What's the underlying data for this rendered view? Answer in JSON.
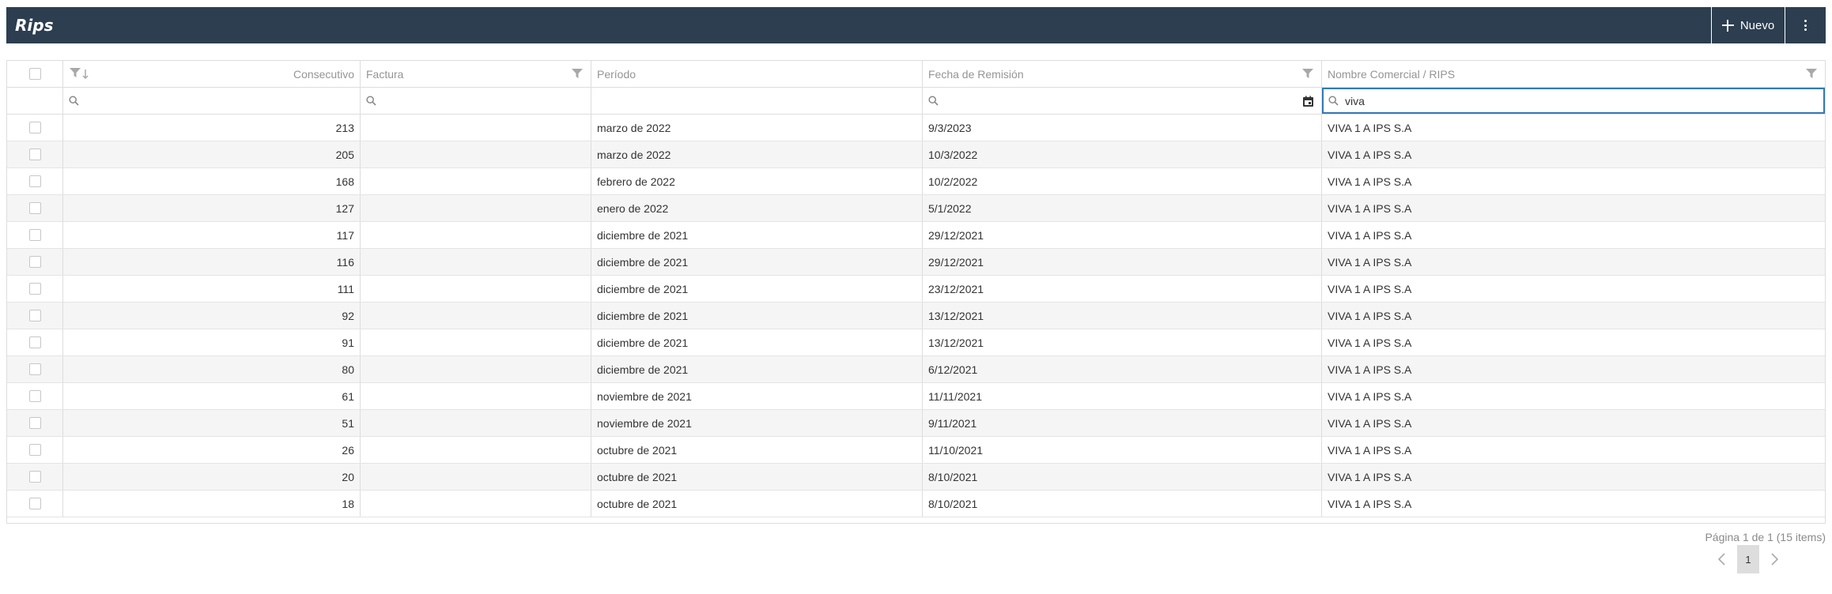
{
  "toolbar": {
    "title": "Rips",
    "new_label": "Nuevo",
    "new_icon": "plus-icon",
    "more_icon": "kebab-menu-icon",
    "background": "#2c3e50"
  },
  "grid": {
    "columns": {
      "consecutivo": "Consecutivo",
      "factura": "Factura",
      "periodo": "Período",
      "fecha": "Fecha de Remisión",
      "nombre": "Nombre Comercial / RIPS"
    },
    "filters": {
      "consecutivo": "",
      "factura": "",
      "fecha": "",
      "nombre": "viva"
    },
    "rows": [
      {
        "consecutivo": "213",
        "factura": "",
        "periodo": "marzo de 2022",
        "fecha": "9/3/2023",
        "nombre": "VIVA 1 A IPS S.A"
      },
      {
        "consecutivo": "205",
        "factura": "",
        "periodo": "marzo de 2022",
        "fecha": "10/3/2022",
        "nombre": "VIVA 1 A IPS S.A"
      },
      {
        "consecutivo": "168",
        "factura": "",
        "periodo": "febrero de 2022",
        "fecha": "10/2/2022",
        "nombre": "VIVA 1 A IPS S.A"
      },
      {
        "consecutivo": "127",
        "factura": "",
        "periodo": "enero de 2022",
        "fecha": "5/1/2022",
        "nombre": "VIVA 1 A IPS S.A"
      },
      {
        "consecutivo": "117",
        "factura": "",
        "periodo": "diciembre de 2021",
        "fecha": "29/12/2021",
        "nombre": "VIVA 1 A IPS S.A"
      },
      {
        "consecutivo": "116",
        "factura": "",
        "periodo": "diciembre de 2021",
        "fecha": "29/12/2021",
        "nombre": "VIVA 1 A IPS S.A"
      },
      {
        "consecutivo": "111",
        "factura": "",
        "periodo": "diciembre de 2021",
        "fecha": "23/12/2021",
        "nombre": "VIVA 1 A IPS S.A"
      },
      {
        "consecutivo": "92",
        "factura": "",
        "periodo": "diciembre de 2021",
        "fecha": "13/12/2021",
        "nombre": "VIVA 1 A IPS S.A"
      },
      {
        "consecutivo": "91",
        "factura": "",
        "periodo": "diciembre de 2021",
        "fecha": "13/12/2021",
        "nombre": "VIVA 1 A IPS S.A"
      },
      {
        "consecutivo": "80",
        "factura": "",
        "periodo": "diciembre de 2021",
        "fecha": "6/12/2021",
        "nombre": "VIVA 1 A IPS S.A"
      },
      {
        "consecutivo": "61",
        "factura": "",
        "periodo": "noviembre de 2021",
        "fecha": "11/11/2021",
        "nombre": "VIVA 1 A IPS S.A"
      },
      {
        "consecutivo": "51",
        "factura": "",
        "periodo": "noviembre de 2021",
        "fecha": "9/11/2021",
        "nombre": "VIVA 1 A IPS S.A"
      },
      {
        "consecutivo": "26",
        "factura": "",
        "periodo": "octubre de 2021",
        "fecha": "11/10/2021",
        "nombre": "VIVA 1 A IPS S.A"
      },
      {
        "consecutivo": "20",
        "factura": "",
        "periodo": "octubre de 2021",
        "fecha": "8/10/2021",
        "nombre": "VIVA 1 A IPS S.A"
      },
      {
        "consecutivo": "18",
        "factura": "",
        "periodo": "octubre de 2021",
        "fecha": "8/10/2021",
        "nombre": "VIVA 1 A IPS S.A"
      }
    ]
  },
  "pager": {
    "info": "Página 1 de 1 (15 items)",
    "current_page": "1"
  },
  "colors": {
    "focus_border": "#337ab7",
    "alt_row": "#f5f5f5",
    "header_text": "#959595"
  }
}
